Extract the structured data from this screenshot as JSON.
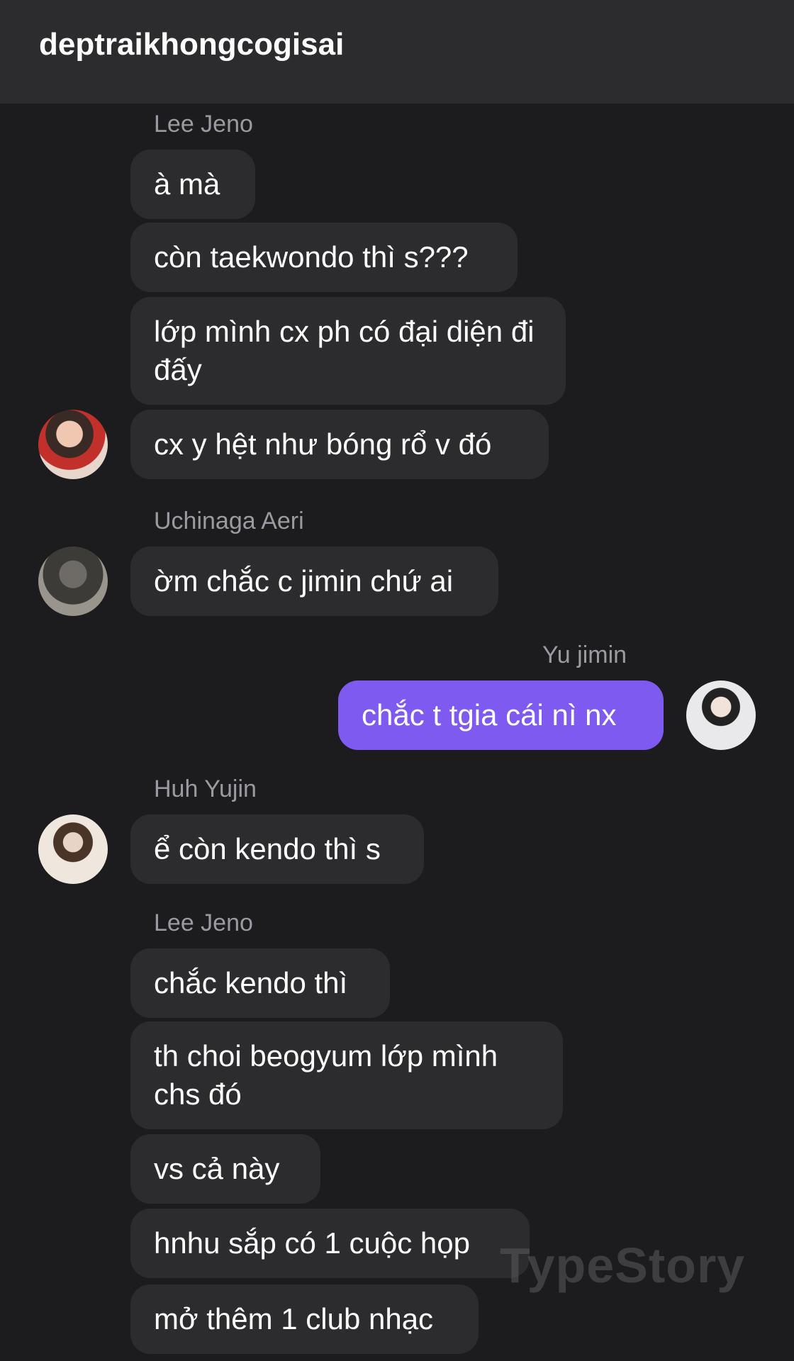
{
  "header": {
    "title": "deptraikhongcogisai"
  },
  "messages": [
    {
      "sender": "Lee Jeno",
      "texts": [
        "à mà",
        "còn taekwondo thì s???",
        "lớp mình cx ph có đại diện đi đấy",
        "cx y hệt như bóng rổ v đó"
      ]
    },
    {
      "sender": "Uchinaga Aeri",
      "texts": [
        "ờm chắc c jimin chứ ai"
      ]
    },
    {
      "sender": "Yu jimin",
      "texts": [
        "chắc t tgia cái nì nx"
      ],
      "mine": true
    },
    {
      "sender": "Huh Yujin",
      "texts": [
        "ể còn kendo thì s"
      ]
    },
    {
      "sender": "Lee Jeno",
      "texts": [
        "chắc kendo thì",
        "th choi beogyum lớp mình chs đó",
        "vs cả này",
        "hnhu sắp có 1 cuộc họp",
        "mở thêm 1 club nhạc"
      ]
    }
  ],
  "watermark": "TypeStory",
  "colors": {
    "background": "#1c1c1e",
    "bubble": "#2c2c2e",
    "my_bubble": "#7f5af0",
    "sender_label": "#9a9aa0"
  }
}
